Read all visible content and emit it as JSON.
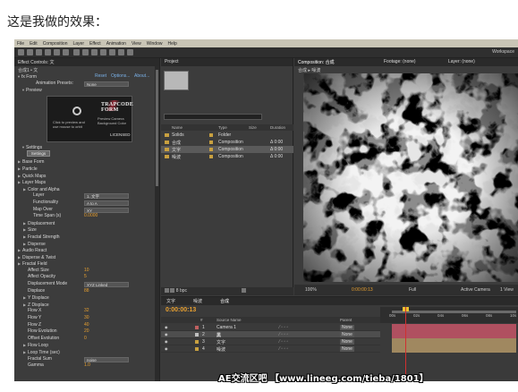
{
  "caption": "这是我做的效果：",
  "menu": [
    "File",
    "Edit",
    "Composition",
    "Layer",
    "Effect",
    "Animation",
    "View",
    "Window",
    "Help"
  ],
  "workspace_label": "Workspace",
  "effect_controls": {
    "tab": "Effect Controls: 文",
    "comp_line": "合成1 • 文",
    "effect_name": "Form",
    "effect_links": [
      "Reset",
      "Options...",
      "About..."
    ],
    "animation_presets_label": "Animation Presets:",
    "animation_presets_value": "None",
    "preview_label": "Preview",
    "preview_hint": "Click to preview and use mouse to orbit",
    "preview_logo": "TRAPCODE FORM",
    "preview_camera": "Preview Camera",
    "preview_bg": "Background Color",
    "license": "LICENSED",
    "settings_label": "Settings",
    "settings_button": "Settings",
    "rows": [
      {
        "label": "Base Form",
        "value": "",
        "level": 1
      },
      {
        "label": "Particle",
        "value": "",
        "level": 1
      },
      {
        "label": "Quick Maps",
        "value": "",
        "level": 1
      },
      {
        "label": "Layer Maps",
        "value": "",
        "level": 1
      },
      {
        "label": "Color and Alpha",
        "value": "",
        "level": 2
      },
      {
        "label": "Layer",
        "value": "1. 文字",
        "level": 3,
        "dropdown": true
      },
      {
        "label": "Functionality",
        "value": "A to A",
        "level": 3,
        "dropdown": true
      },
      {
        "label": "Map Over",
        "value": "XY",
        "level": 3,
        "dropdown": true
      },
      {
        "label": "Time Span (s)",
        "value": "0.0000",
        "level": 3
      },
      {
        "label": "Displacement",
        "value": "",
        "level": 2
      },
      {
        "label": "Size",
        "value": "",
        "level": 2
      },
      {
        "label": "Fractal Strength",
        "value": "",
        "level": 2
      },
      {
        "label": "Disperse",
        "value": "",
        "level": 2
      },
      {
        "label": "Audio React",
        "value": "",
        "level": 1
      },
      {
        "label": "Disperse & Twist",
        "value": "",
        "level": 1
      },
      {
        "label": "Fractal Field",
        "value": "",
        "level": 1
      },
      {
        "label": "Affect Size",
        "value": "10",
        "level": 2
      },
      {
        "label": "Affect Opacity",
        "value": "5",
        "level": 2
      },
      {
        "label": "Displacement Mode",
        "value": "XYZ Linked",
        "level": 2,
        "dropdown": true
      },
      {
        "label": "Displace",
        "value": "88",
        "level": 2
      },
      {
        "label": "Y Displace",
        "value": "",
        "level": 2
      },
      {
        "label": "Z Displace",
        "value": "",
        "level": 2
      },
      {
        "label": "Flow X",
        "value": "32",
        "level": 2
      },
      {
        "label": "Flow Y",
        "value": "30",
        "level": 2
      },
      {
        "label": "Flow Z",
        "value": "40",
        "level": 2
      },
      {
        "label": "Flow Evolution",
        "value": "20",
        "level": 2
      },
      {
        "label": "Offset Evolution",
        "value": "0",
        "level": 2
      },
      {
        "label": "Flow Loop",
        "value": "",
        "level": 2
      },
      {
        "label": "Loop Time (sec)",
        "value": "",
        "level": 2
      },
      {
        "label": "Fractal Sum",
        "value": "noise",
        "level": 2,
        "dropdown": true
      },
      {
        "label": "Gamma",
        "value": "1.0",
        "level": 2
      }
    ]
  },
  "project": {
    "tab": "Project",
    "headers": [
      "Name",
      "Type",
      "Size",
      "Duration"
    ],
    "items": [
      {
        "name": "Solids",
        "type": "Folder",
        "duration": "",
        "color": "#c8a040"
      },
      {
        "name": "合成",
        "type": "Composition",
        "duration": "Δ 0:00",
        "color": "#c8a040"
      },
      {
        "name": "文字",
        "type": "Composition",
        "duration": "Δ 0:00",
        "color": "#c8a040",
        "selected": true
      },
      {
        "name": "噪波",
        "type": "Composition",
        "duration": "Δ 0:00",
        "color": "#c8a040"
      }
    ],
    "footer": "8 bpc"
  },
  "composition": {
    "tabs": [
      "Composition: 合成",
      "Footage: (none)",
      "Layer: (none)"
    ],
    "sub": [
      "合成",
      "噪波"
    ],
    "footer": {
      "zoom": "100%",
      "time": "0:00:00:13",
      "quality": "Full",
      "camera": "Active Camera",
      "view": "1 View"
    }
  },
  "timeline": {
    "tabs": [
      "文字",
      "噪波",
      "合成"
    ],
    "current_time": "0:00:00:13",
    "col_headers": [
      "#",
      "Source Name",
      "Parent"
    ],
    "ruler": [
      "00s",
      "02s",
      "04s",
      "06s",
      "08s",
      "10s"
    ],
    "layers": [
      {
        "index": "1",
        "name": "Camera 1",
        "parent": "None",
        "label_color": "#c06060",
        "track_color": "#b05060"
      },
      {
        "index": "2",
        "name": "黑",
        "parent": "None",
        "label_color": "#c0c0c0",
        "track_color": "#b05060",
        "selected": true
      },
      {
        "index": "3",
        "name": "文字",
        "parent": "None",
        "label_color": "#c8a040",
        "track_color": "#a08860"
      },
      {
        "index": "4",
        "name": "噪波",
        "parent": "None",
        "label_color": "#c8a040",
        "track_color": "#a08860"
      }
    ]
  },
  "watermark": "AE交流区吧 【www.lineeg.com/tieba/1801】"
}
